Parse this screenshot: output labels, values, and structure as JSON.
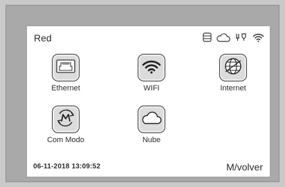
{
  "header": {
    "title": "Red",
    "status_icons": [
      "storage-icon",
      "cloud-icon",
      "plug-icon",
      "wifi-icon"
    ]
  },
  "menu": {
    "items": [
      {
        "label": "Ethernet",
        "icon": "ethernet-icon"
      },
      {
        "label": "WIFI",
        "icon": "wifi-icon"
      },
      {
        "label": "Internet",
        "icon": "globe-icon"
      },
      {
        "label": "Com Modo",
        "icon": "mode-icon"
      },
      {
        "label": "Nube",
        "icon": "cloud-icon"
      }
    ]
  },
  "footer": {
    "datetime": "06-11-2018  13:09:52",
    "back_label": "M/volver"
  }
}
